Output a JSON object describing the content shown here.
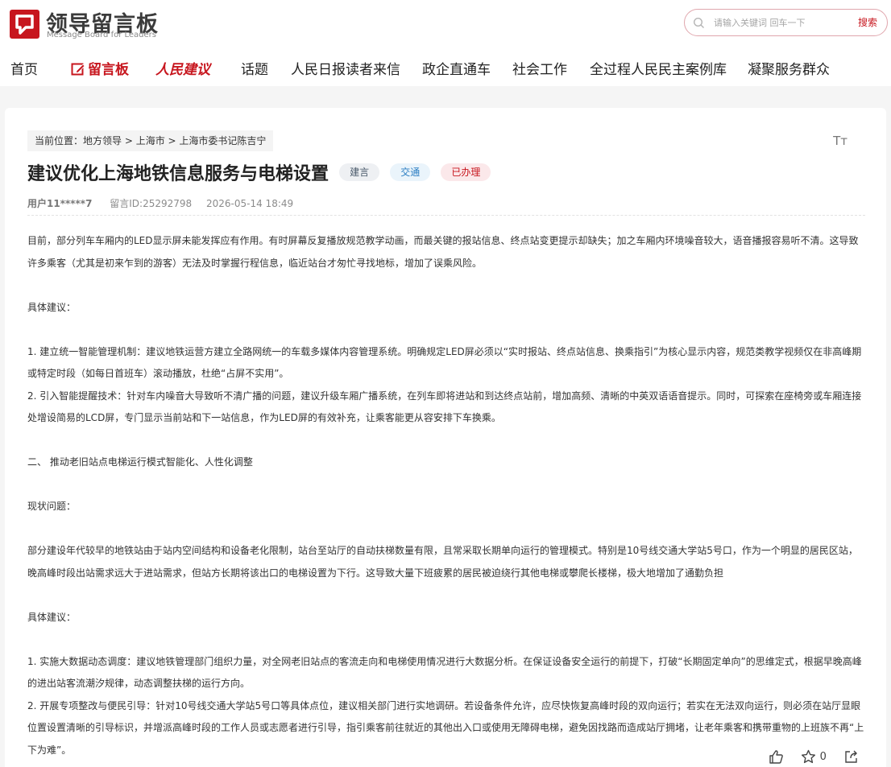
{
  "logo": {
    "title": "领导留言板",
    "subtitle": "Message Board for Leaders"
  },
  "search": {
    "placeholder": "请输入关键词 回车一下",
    "button": "搜索"
  },
  "nav": {
    "home": "首页",
    "board": "留言板",
    "suggest": "人民建议",
    "topics": "话题",
    "reader": "人民日报读者来信",
    "enterprise": "政企直通车",
    "social": "社会工作",
    "cases": "全过程人民民主案例库",
    "service": "凝聚服务群众"
  },
  "breadcrumb": {
    "label": "当前位置：",
    "crumb1": "地方领导",
    "sep": " > ",
    "crumb2": "上海市",
    "crumb3": "上海市委书记陈吉宁"
  },
  "font_size_icon": "Tт",
  "post": {
    "title": "建议优化上海地铁信息服务与电梯设置",
    "tags": [
      "建言",
      "交通",
      "已办理"
    ],
    "user": "用户11*****7",
    "message_id": "留言ID:25292798",
    "time": "2026-05-14 18:49"
  },
  "content": {
    "p1": "目前，部分列车车厢内的LED显示屏未能发挥应有作用。有时屏幕反复播放规范教学动画，而最关键的报站信息、终点站变更提示却缺失；加之车厢内环境噪音较大，语音播报容易听不清。这导致许多乘客（尤其是初来乍到的游客）无法及时掌握行程信息，临近站台才匆忙寻找地标，增加了误乘风险。",
    "p2": "具体建议：",
    "p3": "1. 建立统一智能管理机制：建议地铁运营方建立全路网统一的车载多媒体内容管理系统。明确规定LED屏必须以“实时报站、终点站信息、换乘指引”为核心显示内容，规范类教学视频仅在非高峰期或特定时段（如每日首班车）滚动播放，杜绝“占屏不实用”。",
    "p4": "2. 引入智能提醒技术：针对车内噪音大导致听不清广播的问题，建议升级车厢广播系统，在列车即将进站和到达终点站前，增加高频、清晰的中英双语语音提示。同时，可探索在座椅旁或车厢连接处增设简易的LCD屏，专门显示当前站和下一站信息，作为LED屏的有效补充，让乘客能更从容安排下车换乘。",
    "p5": "二、 推动老旧站点电梯运行模式智能化、人性化调整",
    "p6": "现状问题：",
    "p7": "部分建设年代较早的地铁站由于站内空间结构和设备老化限制，站台至站厅的自动扶梯数量有限，且常采取长期单向运行的管理模式。特别是10号线交通大学站5号口，作为一个明显的居民区站，晚高峰时段出站需求远大于进站需求，但站方长期将该出口的电梯设置为下行。这导致大量下班疲累的居民被迫绕行其他电梯或攀爬长楼梯，极大地增加了通勤负担",
    "p8": "具体建议：",
    "p9": "1. 实施大数据动态调度：建议地铁管理部门组织力量，对全网老旧站点的客流走向和电梯使用情况进行大数据分析。在保证设备安全运行的前提下，打破“长期固定单向”的思维定式，根据早晚高峰的进出站客流潮汐规律，动态调整扶梯的运行方向。",
    "p10": "2. 开展专项整改与便民引导：针对10号线交通大学站5号口等具体点位，建议相关部门进行实地调研。若设备条件允许，应尽快恢复高峰时段的双向运行；若实在无法双向运行，则必须在站厅显眼位置设置清晰的引导标识，并增派高峰时段的工作人员或志愿者进行引导，指引乘客前往就近的其他出入口或使用无障碍电梯，避免因找路而造成站厅拥堵，让老年乘客和携带重物的上班族不再“上下为难”。"
  },
  "actions": {
    "favorite_count": "0"
  },
  "colors": {
    "brand_red": "#c7161e",
    "tag_blue": "#2a7dc2",
    "background": "#f5f5f5"
  }
}
